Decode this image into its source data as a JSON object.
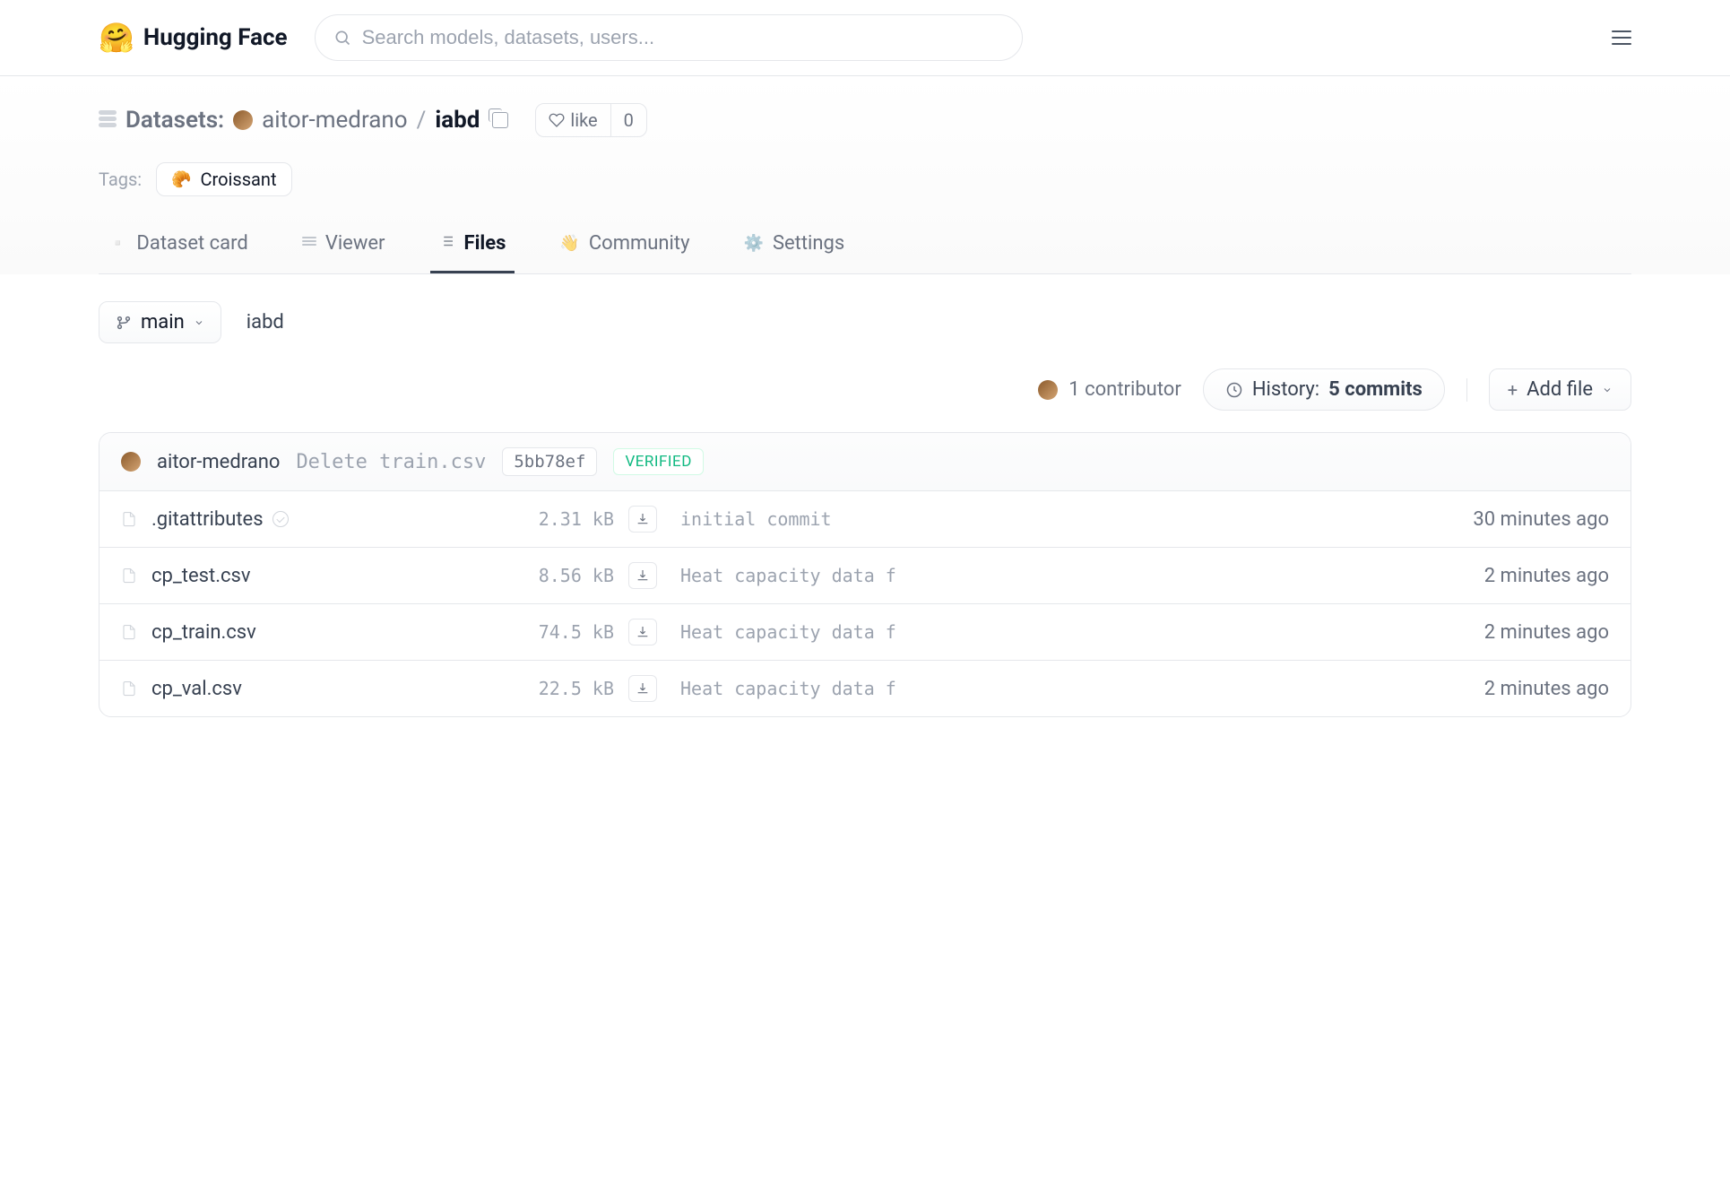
{
  "header": {
    "brand": "Hugging Face",
    "search_placeholder": "Search models, datasets, users..."
  },
  "breadcrumb": {
    "section": "Datasets:",
    "owner": "aitor-medrano",
    "name": "iabd",
    "like_label": "like",
    "like_count": "0"
  },
  "tags": {
    "label": "Tags:",
    "items": [
      {
        "emoji": "🥐",
        "label": "Croissant"
      }
    ]
  },
  "tabs": [
    {
      "icon": "📦",
      "label": "Dataset card",
      "active": false
    },
    {
      "icon": "grid",
      "label": "Viewer",
      "active": false
    },
    {
      "icon": "list",
      "label": "Files",
      "active": true
    },
    {
      "icon": "👋",
      "label": "Community",
      "active": false
    },
    {
      "icon": "⚙️",
      "label": "Settings",
      "active": false
    }
  ],
  "branch": {
    "name": "main",
    "path": "iabd"
  },
  "meta": {
    "contributors": "1 contributor",
    "history_label": "History:",
    "history_count": "5 commits",
    "add_file": "Add file"
  },
  "commit": {
    "author": "aitor-medrano",
    "message": "Delete train.csv",
    "hash": "5bb78ef",
    "verified": "VERIFIED"
  },
  "files": [
    {
      "name": ".gitattributes",
      "safe": true,
      "size": "2.31 kB",
      "msg": "initial commit",
      "time": "30 minutes ago"
    },
    {
      "name": "cp_test.csv",
      "safe": false,
      "size": "8.56 kB",
      "msg": "Heat capacity data f",
      "time": "2 minutes ago"
    },
    {
      "name": "cp_train.csv",
      "safe": false,
      "size": "74.5 kB",
      "msg": "Heat capacity data f",
      "time": "2 minutes ago"
    },
    {
      "name": "cp_val.csv",
      "safe": false,
      "size": "22.5 kB",
      "msg": "Heat capacity data f",
      "time": "2 minutes ago"
    }
  ]
}
